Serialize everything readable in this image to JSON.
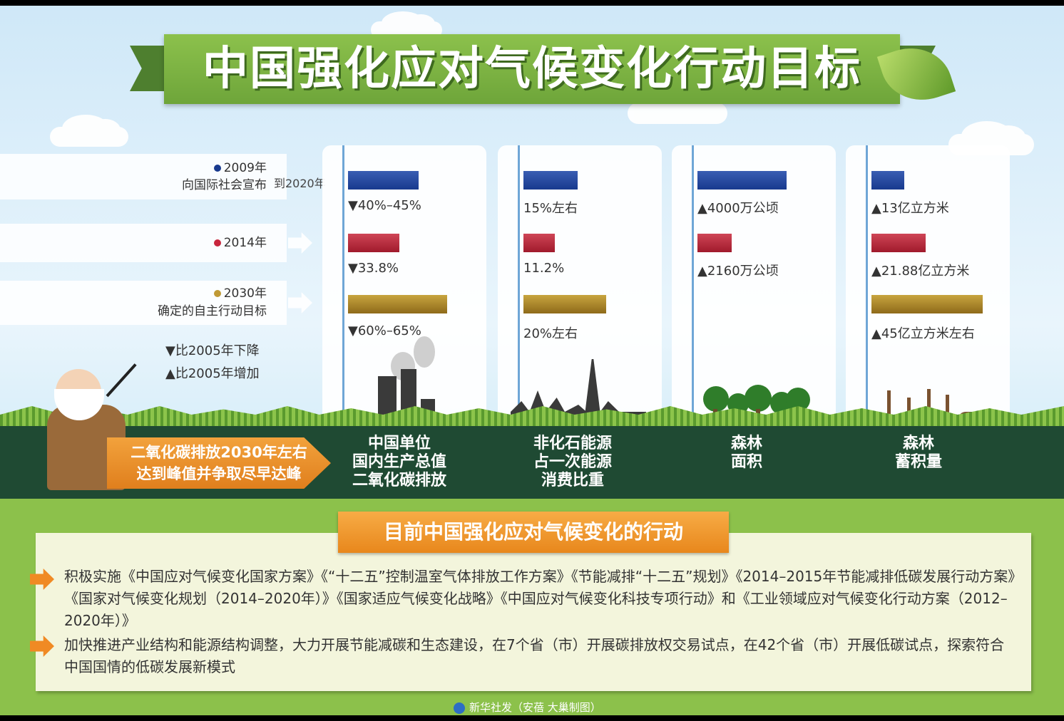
{
  "title": "中国强化应对气候变化行动目标",
  "labels": {
    "y2009_year": "2009年",
    "y2009_desc": "向国际社会宣布",
    "to_2020": "到2020年",
    "y2014": "2014年",
    "y2030_year": "2030年",
    "y2030_desc": "确定的自主行动目标",
    "legend_down": "▼比2005年下降",
    "legend_up": "▲比2005年增加"
  },
  "panels": [
    {
      "v2020": "▼40%–45%",
      "v2014": "▼33.8%",
      "v2030": "▼60%–65%",
      "f2020": 0.52,
      "f2014": 0.38,
      "f2030": 0.73
    },
    {
      "v2020": "15%左右",
      "v2014": "11.2%",
      "v2030": "20%左右",
      "f2020": 0.4,
      "f2014": 0.23,
      "f2030": 0.61
    },
    {
      "v2020": "▲4000万公顷",
      "v2014": "▲2160万公顷",
      "v2030": "",
      "f2020": 0.66,
      "f2014": 0.25,
      "f2030": 0
    },
    {
      "v2020": "▲13亿立方米",
      "v2014": "▲21.88亿立方米",
      "v2030": "▲45亿立方米左右",
      "f2020": 0.24,
      "f2014": 0.4,
      "f2030": 0.82
    }
  ],
  "categories": [
    "中国单位\n国内生产总值\n二氧化碳排放",
    "非化石能源\n占一次能源\n消费比重",
    "森林\n面积",
    "森林\n蓄积量"
  ],
  "peak_text": "二氧化碳排放2030年左右\n达到峰值并争取尽早达峰",
  "section_title": "目前中国强化应对气候变化的行动",
  "paragraphs": [
    "积极实施《中国应对气候变化国家方案》《“十二五”控制温室气体排放工作方案》《节能减排“十二五”规划》《2014–2015年节能减排低碳发展行动方案》《国家对气候变化规划（2014–2020年）》《国家适应气候变化战略》《中国应对气候变化科技专项行动》和《工业领域应对气候变化行动方案（2012–2020年）》",
    "加快推进产业结构和能源结构调整，大力开展节能减碳和生态建设，在7个省（市）开展碳排放权交易试点，在42个省（市）开展低碳试点，探索符合中国国情的低碳发展新模式"
  ],
  "credit": "新华社发（安蓓  大巢制图）",
  "colors": {
    "blue": "#183a8e",
    "red": "#a01a2c",
    "gold": "#8e6a1a",
    "accent": "#e8871c",
    "green": "#6ea53a"
  }
}
